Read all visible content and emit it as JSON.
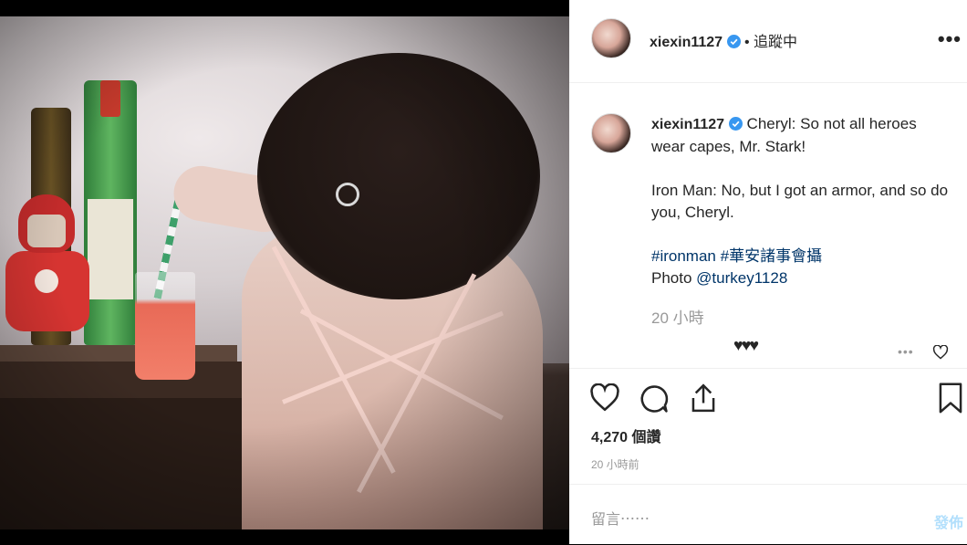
{
  "header": {
    "username": "xiexin1127",
    "separator": "•",
    "follow_status": "追蹤中",
    "more_icon": "more-horizontal-icon"
  },
  "caption": {
    "username": "xiexin1127",
    "line1": "Cheryl: So not all heroes wear capes, Mr. Stark!",
    "line2": "Iron Man: No, but I got an armor, and so do you, Cheryl.",
    "hashtag1": "#ironman",
    "hashtag2": "#華安諸事會攝",
    "photo_prefix": "Photo",
    "photo_credit": "@turkey1128",
    "time": "20 小時"
  },
  "comment_preview": {
    "hearts": "♥♥♥"
  },
  "actions": {
    "like_icon": "heart-icon",
    "comment_icon": "comment-icon",
    "share_icon": "share-icon",
    "save_icon": "bookmark-icon"
  },
  "stats": {
    "views": "4,270 個讚",
    "posted_ago": "20 小時前"
  },
  "comment_box": {
    "placeholder": "留言⋯⋯",
    "post_label": "發佈"
  },
  "colors": {
    "verified_blue": "#3897f0",
    "hashtag": "#003569",
    "muted": "#999999",
    "post_disabled": "#b2dffc"
  }
}
